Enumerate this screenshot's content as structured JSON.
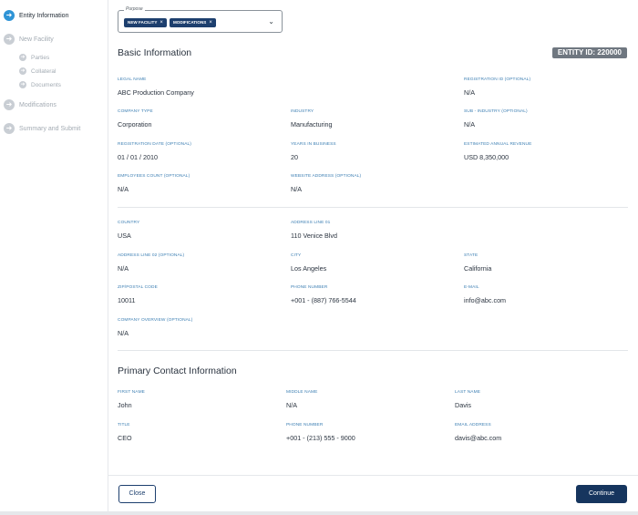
{
  "sidebar": {
    "steps": [
      {
        "label": "Entity Information",
        "icon": "arrow-right-icon",
        "active": true
      },
      {
        "label": "New Facility",
        "icon": "arrow-right-icon",
        "active": false
      },
      {
        "label": "Modifications",
        "icon": "arrow-right-icon",
        "active": false
      },
      {
        "label": "Summary and Submit",
        "icon": "arrow-right-icon",
        "active": false
      }
    ],
    "substeps": [
      {
        "label": "Parties",
        "icon": "arrow-right-icon"
      },
      {
        "label": "Collateral",
        "icon": "arrow-right-icon"
      },
      {
        "label": "Documents",
        "icon": "arrow-right-icon"
      }
    ]
  },
  "purpose": {
    "legend": "Purpose",
    "chips": [
      {
        "label": "NEW FACILITY",
        "remove": "×"
      },
      {
        "label": "MODIFICATIONS",
        "remove": "×"
      }
    ],
    "chevron": "⌄"
  },
  "basic_info": {
    "title": "Basic Information",
    "entity_id": "ENTITY ID: 220000",
    "fields": {
      "legal_name": {
        "label": "LEGAL NAME",
        "value": "ABC Production Company"
      },
      "registration_id": {
        "label": "REGISTRATION ID (OPTIONAL)",
        "value": "N/A"
      },
      "company_type": {
        "label": "COMPANY TYPE",
        "value": "Corporation"
      },
      "industry": {
        "label": "INDUSTRY",
        "value": "Manufacturing"
      },
      "sub_industry": {
        "label": "SUB - INDUSTRY (OPTIONAL)",
        "value": "N/A"
      },
      "registration_date": {
        "label": "REGISTRATION DATE (OPTIONAL)",
        "value": "01 / 01 / 2010"
      },
      "years_in_business": {
        "label": "YEARS IN BUSINESS",
        "value": "20"
      },
      "annual_revenue": {
        "label": "ESTIMATED ANNUAL REVENUE",
        "value": "USD 8,350,000"
      },
      "employees_count": {
        "label": "EMPLOYEES COUNT (OPTIONAL)",
        "value": "N/A"
      },
      "website": {
        "label": "WEBSITE ADDRESS (OPTIONAL)",
        "value": "N/A"
      }
    }
  },
  "address": {
    "fields": {
      "country": {
        "label": "COUNTRY",
        "value": "USA"
      },
      "address_line_1": {
        "label": "ADDRESS LINE 01",
        "value": "110 Venice Blvd"
      },
      "address_line_2": {
        "label": "ADDRESS LINE 02 (OPTIONAL)",
        "value": "N/A"
      },
      "city": {
        "label": "CITY",
        "value": "Los Angeles"
      },
      "state": {
        "label": "STATE",
        "value": "California"
      },
      "zip": {
        "label": "ZIP/POSTAL CODE",
        "value": "10011"
      },
      "phone": {
        "label": "PHONE NUMBER",
        "value": "+001 - (887) 766-5544"
      },
      "email": {
        "label": "E-MAIL",
        "value": "info@abc.com"
      },
      "overview": {
        "label": "COMPANY OVERVIEW (OPTIONAL)",
        "value": "N/A"
      }
    }
  },
  "primary_contact": {
    "title": "Primary Contact Information",
    "fields": {
      "first_name": {
        "label": "FIRST NAME",
        "value": "John"
      },
      "middle_name": {
        "label": "MIDDLE NAME",
        "value": "N/A"
      },
      "last_name": {
        "label": "LAST NAME",
        "value": "Davis"
      },
      "title": {
        "label": "TITLE",
        "value": "CEO"
      },
      "phone": {
        "label": "PHONE NUMBER",
        "value": "+001  - (213) 555 - 9000"
      },
      "email": {
        "label": "EMAIL ADDRESS",
        "value": "davis@abc.com"
      }
    }
  },
  "footer": {
    "close_label": "Close",
    "continue_label": "Continue"
  },
  "colors": {
    "accent": "#2f94d6",
    "primary_button": "#16355e",
    "chip": "#1d3f6e",
    "label": "#3d7fb3",
    "badge": "#6f7780"
  }
}
